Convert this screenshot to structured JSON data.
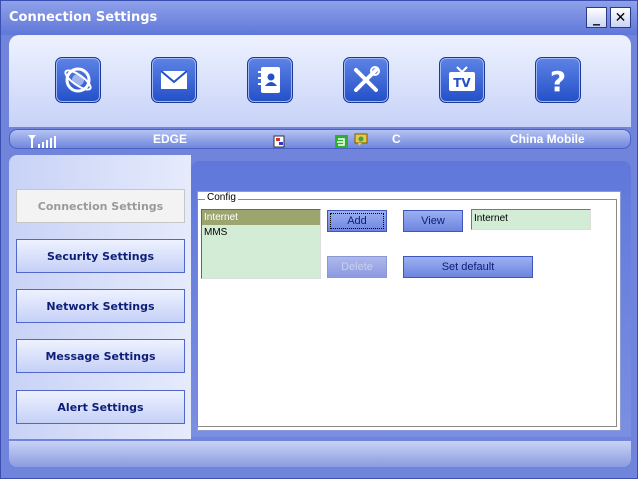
{
  "window": {
    "title": "Connection Settings",
    "minimize_label": "_",
    "close_label": "✕"
  },
  "toolbar": {
    "icons": [
      {
        "name": "internet-icon"
      },
      {
        "name": "message-icon"
      },
      {
        "name": "contacts-icon"
      },
      {
        "name": "settings-icon"
      },
      {
        "name": "tv-icon",
        "label": "TV"
      },
      {
        "name": "help-icon",
        "label": "?"
      }
    ]
  },
  "status": {
    "network_type": "EDGE",
    "connection_indicator": "C",
    "operator": "China Mobile"
  },
  "sidebar": {
    "items": [
      {
        "label": "Connection Settings",
        "active": true
      },
      {
        "label": "Security Settings",
        "active": false
      },
      {
        "label": "Network Settings",
        "active": false
      },
      {
        "label": "Message Settings",
        "active": false
      },
      {
        "label": "Alert Settings",
        "active": false
      }
    ]
  },
  "config": {
    "legend": "Config",
    "items": [
      {
        "label": "Internet",
        "selected": true
      },
      {
        "label": "MMS",
        "selected": false
      }
    ],
    "add_label": "Add",
    "view_label": "View",
    "delete_label": "Delete",
    "set_default_label": "Set default",
    "name_value": "Internet"
  },
  "colors": {
    "accent": "#5f77d8",
    "selected_item": "#9da56f",
    "field_bg": "#d3ecd6"
  }
}
